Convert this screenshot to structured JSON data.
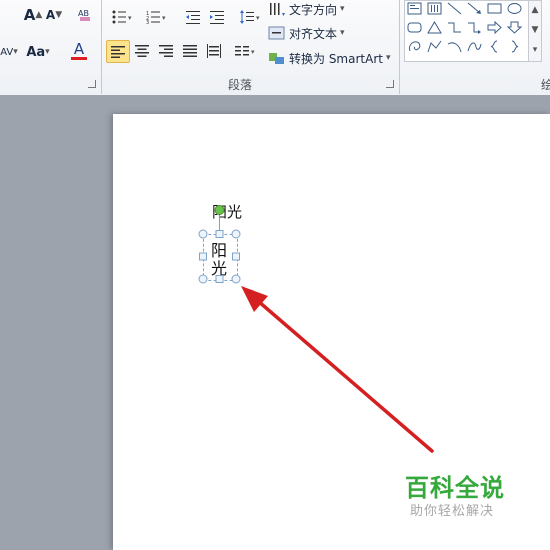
{
  "ribbon": {
    "paragraph_group_label": "段落",
    "next_group_label_partial": "绘",
    "text_direction_label": "文字方向",
    "align_text_label": "对齐文本",
    "convert_smartart_label": "转换为 SmartArt",
    "dropdown_glyph": "▾"
  },
  "font_buttons": {
    "grow": "A",
    "shrink": "A",
    "spacing": "AV",
    "change_case": "Aa",
    "font_color": "A",
    "font_color_value": "#e02020"
  },
  "document": {
    "text_unrotated": "阳光",
    "text_box_line1": "阳",
    "text_box_line2": "光"
  },
  "watermark": {
    "title": "百科全说",
    "subtitle": "助你轻松解决"
  },
  "colors": {
    "arrow": "#d42020",
    "handle": "#7fa3c8",
    "rotate_handle": "#69c24a",
    "watermark_green": "#35a93c"
  }
}
